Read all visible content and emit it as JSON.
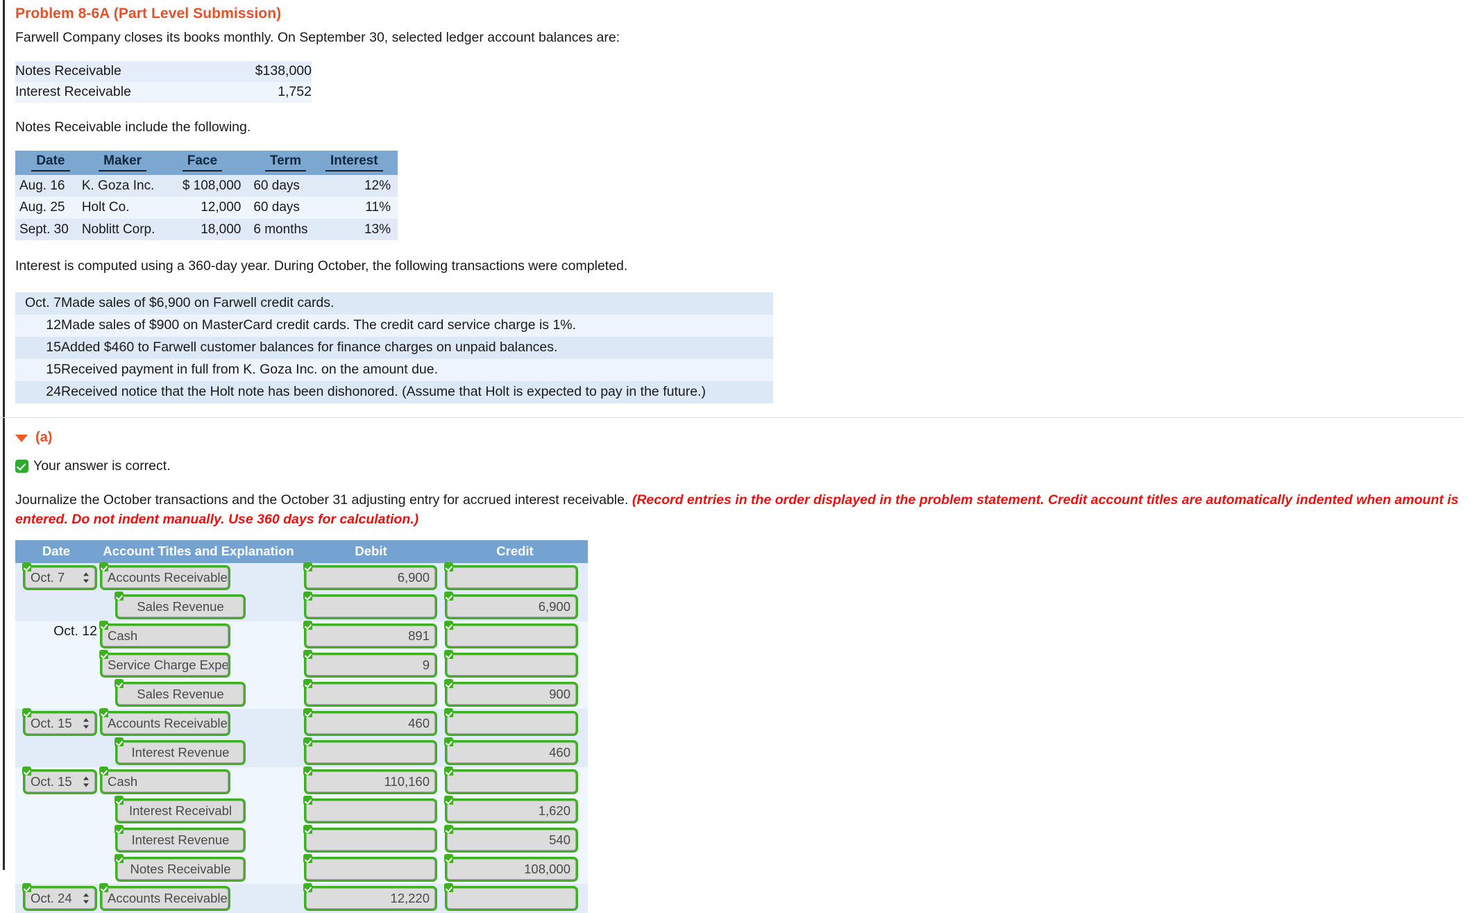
{
  "problem": {
    "title": "Problem 8-6A (Part Level Submission)",
    "intro": "Farwell Company closes its books monthly. On September 30, selected ledger account balances are:",
    "notes_lead": "Notes Receivable include the following.",
    "interest_note": "Interest is computed using a 360-day year. During October, the following transactions were completed."
  },
  "balances": [
    {
      "label": "Notes Receivable",
      "amount": "$138,000"
    },
    {
      "label": "Interest Receivable",
      "amount": "1,752"
    }
  ],
  "notes_table": {
    "headers": [
      "Date",
      "Maker",
      "Face",
      "Term",
      "Interest"
    ],
    "rows": [
      {
        "date": "Aug. 16",
        "maker": "K. Goza Inc.",
        "face": "$ 108,000",
        "term": "60 days",
        "interest": "12%"
      },
      {
        "date": "Aug. 25",
        "maker": "Holt Co.",
        "face": "12,000",
        "term": "60 days",
        "interest": "11%"
      },
      {
        "date": "Sept. 30",
        "maker": "Noblitt Corp.",
        "face": "18,000",
        "term": "6 months",
        "interest": "13%"
      }
    ]
  },
  "transactions": [
    {
      "date": "Oct. 7",
      "text": "Made sales of $6,900 on Farwell credit cards."
    },
    {
      "date": "12",
      "text": "Made sales of $900 on MasterCard credit cards. The credit card service charge is 1%."
    },
    {
      "date": "15",
      "text": "Added $460 to Farwell customer balances for finance charges on unpaid balances."
    },
    {
      "date": "15",
      "text": "Received payment in full from K. Goza Inc. on the amount due."
    },
    {
      "date": "24",
      "text": "Received notice that the Holt note has been dishonored. (Assume that Holt is expected to pay in the future.)"
    }
  ],
  "part_a": {
    "label": "(a)",
    "correct_message": "Your answer is correct.",
    "instruction_plain": "Journalize the October transactions and the October 31 adjusting entry for accrued interest receivable.",
    "instruction_red": "(Record entries in the order displayed in the problem statement. Credit account titles are automatically indented when amount is entered. Do not indent manually. Use 360 days for calculation.)"
  },
  "journal": {
    "headers": [
      "Date",
      "Account Titles and Explanation",
      "Debit",
      "Credit"
    ],
    "rows": [
      {
        "group": 1,
        "date": "Oct. 7",
        "date_type": "select",
        "account": "Accounts Receivable",
        "indent": false,
        "debit": "6,900",
        "credit": ""
      },
      {
        "group": 1,
        "date": "",
        "date_type": "none",
        "account": "Sales Revenue",
        "indent": true,
        "debit": "",
        "credit": "6,900"
      },
      {
        "group": 2,
        "date": "Oct. 12",
        "date_type": "text",
        "account": "Cash",
        "indent": false,
        "debit": "891",
        "credit": ""
      },
      {
        "group": 2,
        "date": "",
        "date_type": "none",
        "account": "Service Charge Expe",
        "indent": false,
        "debit": "9",
        "credit": ""
      },
      {
        "group": 2,
        "date": "",
        "date_type": "none",
        "account": "Sales Revenue",
        "indent": true,
        "debit": "",
        "credit": "900"
      },
      {
        "group": 3,
        "date": "Oct. 15",
        "date_type": "select",
        "account": "Accounts Receivable",
        "indent": false,
        "debit": "460",
        "credit": ""
      },
      {
        "group": 3,
        "date": "",
        "date_type": "none",
        "account": "Interest Revenue",
        "indent": true,
        "debit": "",
        "credit": "460"
      },
      {
        "group": 4,
        "date": "Oct. 15",
        "date_type": "select",
        "account": "Cash",
        "indent": false,
        "debit": "110,160",
        "credit": ""
      },
      {
        "group": 4,
        "date": "",
        "date_type": "none",
        "account": "Interest Receivabl",
        "indent": true,
        "debit": "",
        "credit": "1,620"
      },
      {
        "group": 4,
        "date": "",
        "date_type": "none",
        "account": "Interest Revenue",
        "indent": true,
        "debit": "",
        "credit": "540"
      },
      {
        "group": 4,
        "date": "",
        "date_type": "none",
        "account": "Notes Receivable",
        "indent": true,
        "debit": "",
        "credit": "108,000"
      },
      {
        "group": 5,
        "date": "Oct. 24",
        "date_type": "select",
        "account": "Accounts Receivable",
        "indent": false,
        "debit": "12,220",
        "credit": ""
      }
    ]
  }
}
